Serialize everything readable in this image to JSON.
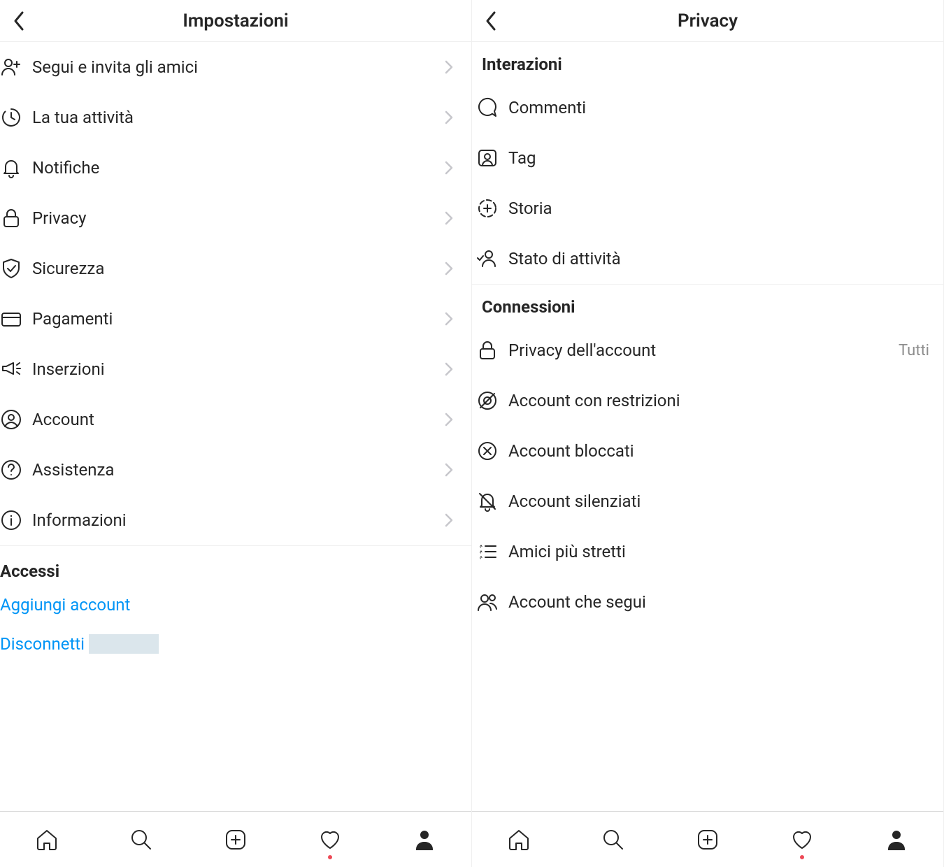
{
  "left": {
    "title": "Impostazioni",
    "items": [
      {
        "label": "Segui e invita gli amici"
      },
      {
        "label": "La tua attività"
      },
      {
        "label": "Notifiche"
      },
      {
        "label": "Privacy"
      },
      {
        "label": "Sicurezza"
      },
      {
        "label": "Pagamenti"
      },
      {
        "label": "Inserzioni"
      },
      {
        "label": "Account"
      },
      {
        "label": "Assistenza"
      },
      {
        "label": "Informazioni"
      }
    ],
    "logins_header": "Accessi",
    "add_account": "Aggiungi account",
    "logout": "Disconnetti"
  },
  "right": {
    "title": "Privacy",
    "section1": "Interazioni",
    "section2": "Connessioni",
    "interactions": [
      {
        "label": "Commenti"
      },
      {
        "label": "Tag"
      },
      {
        "label": "Storia"
      },
      {
        "label": "Stato di attività"
      }
    ],
    "connections": [
      {
        "label": "Privacy dell'account",
        "meta": "Tutti"
      },
      {
        "label": "Account con restrizioni"
      },
      {
        "label": "Account bloccati"
      },
      {
        "label": "Account silenziati"
      },
      {
        "label": "Amici più stretti"
      },
      {
        "label": "Account che segui"
      }
    ]
  }
}
